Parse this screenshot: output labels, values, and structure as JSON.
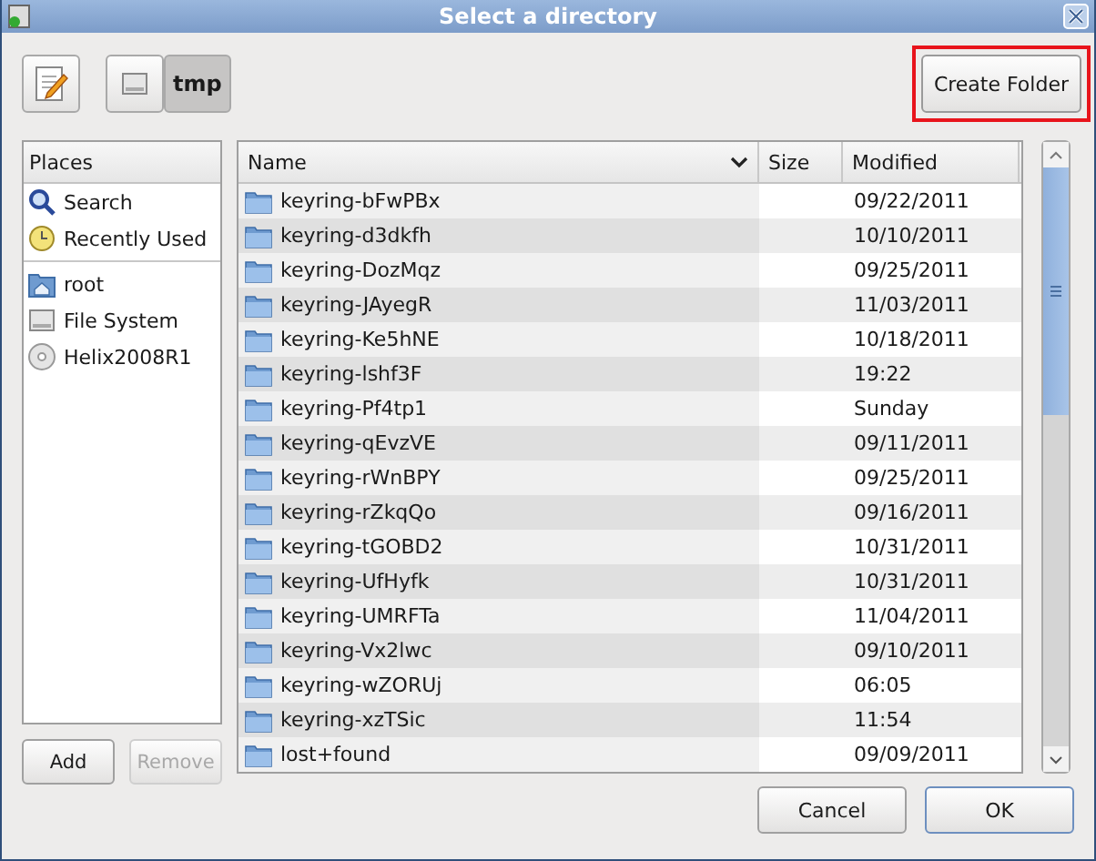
{
  "window": {
    "title": "Select a directory"
  },
  "toolbar": {
    "path": [
      {
        "kind": "drive",
        "selected": false
      },
      {
        "kind": "label",
        "label": "tmp",
        "selected": true
      }
    ],
    "create_folder": {
      "label": "Create Folder",
      "highlighted": true
    }
  },
  "places": {
    "title": "Places",
    "groups": [
      [
        {
          "kind": "search",
          "label": "Search"
        },
        {
          "kind": "recent",
          "label": "Recently Used"
        }
      ],
      [
        {
          "kind": "home",
          "label": "root"
        },
        {
          "kind": "drive",
          "label": "File System"
        },
        {
          "kind": "disc",
          "label": "Helix2008R1"
        }
      ]
    ],
    "buttons": [
      {
        "label": "Add",
        "disabled": false
      },
      {
        "label": "Remove",
        "disabled": true
      }
    ]
  },
  "table": {
    "columns": [
      "Name",
      "Size",
      "Modified"
    ],
    "rows": [
      {
        "name": "keyring-bFwPBx",
        "modified": "09/22/2011"
      },
      {
        "name": "keyring-d3dkfh",
        "modified": "10/10/2011"
      },
      {
        "name": "keyring-DozMqz",
        "modified": "09/25/2011"
      },
      {
        "name": "keyring-JAyegR",
        "modified": "11/03/2011"
      },
      {
        "name": "keyring-Ke5hNE",
        "modified": "10/18/2011"
      },
      {
        "name": "keyring-lshf3F",
        "modified": "19:22"
      },
      {
        "name": "keyring-Pf4tp1",
        "modified": "Sunday"
      },
      {
        "name": "keyring-qEvzVE",
        "modified": "09/11/2011"
      },
      {
        "name": "keyring-rWnBPY",
        "modified": "09/25/2011"
      },
      {
        "name": "keyring-rZkqQo",
        "modified": "09/16/2011"
      },
      {
        "name": "keyring-tGOBD2",
        "modified": "10/31/2011"
      },
      {
        "name": "keyring-UfHyfk",
        "modified": "10/31/2011"
      },
      {
        "name": "keyring-UMRFTa",
        "modified": "11/04/2011"
      },
      {
        "name": "keyring-Vx2lwc",
        "modified": "09/10/2011"
      },
      {
        "name": "keyring-wZORUj",
        "modified": "06:05"
      },
      {
        "name": "keyring-xzTSic",
        "modified": "11:54"
      },
      {
        "name": "lost+found",
        "modified": "09/09/2011"
      }
    ]
  },
  "buttons": [
    {
      "label": "Cancel",
      "default": false
    },
    {
      "label": "OK",
      "default": true
    }
  ]
}
